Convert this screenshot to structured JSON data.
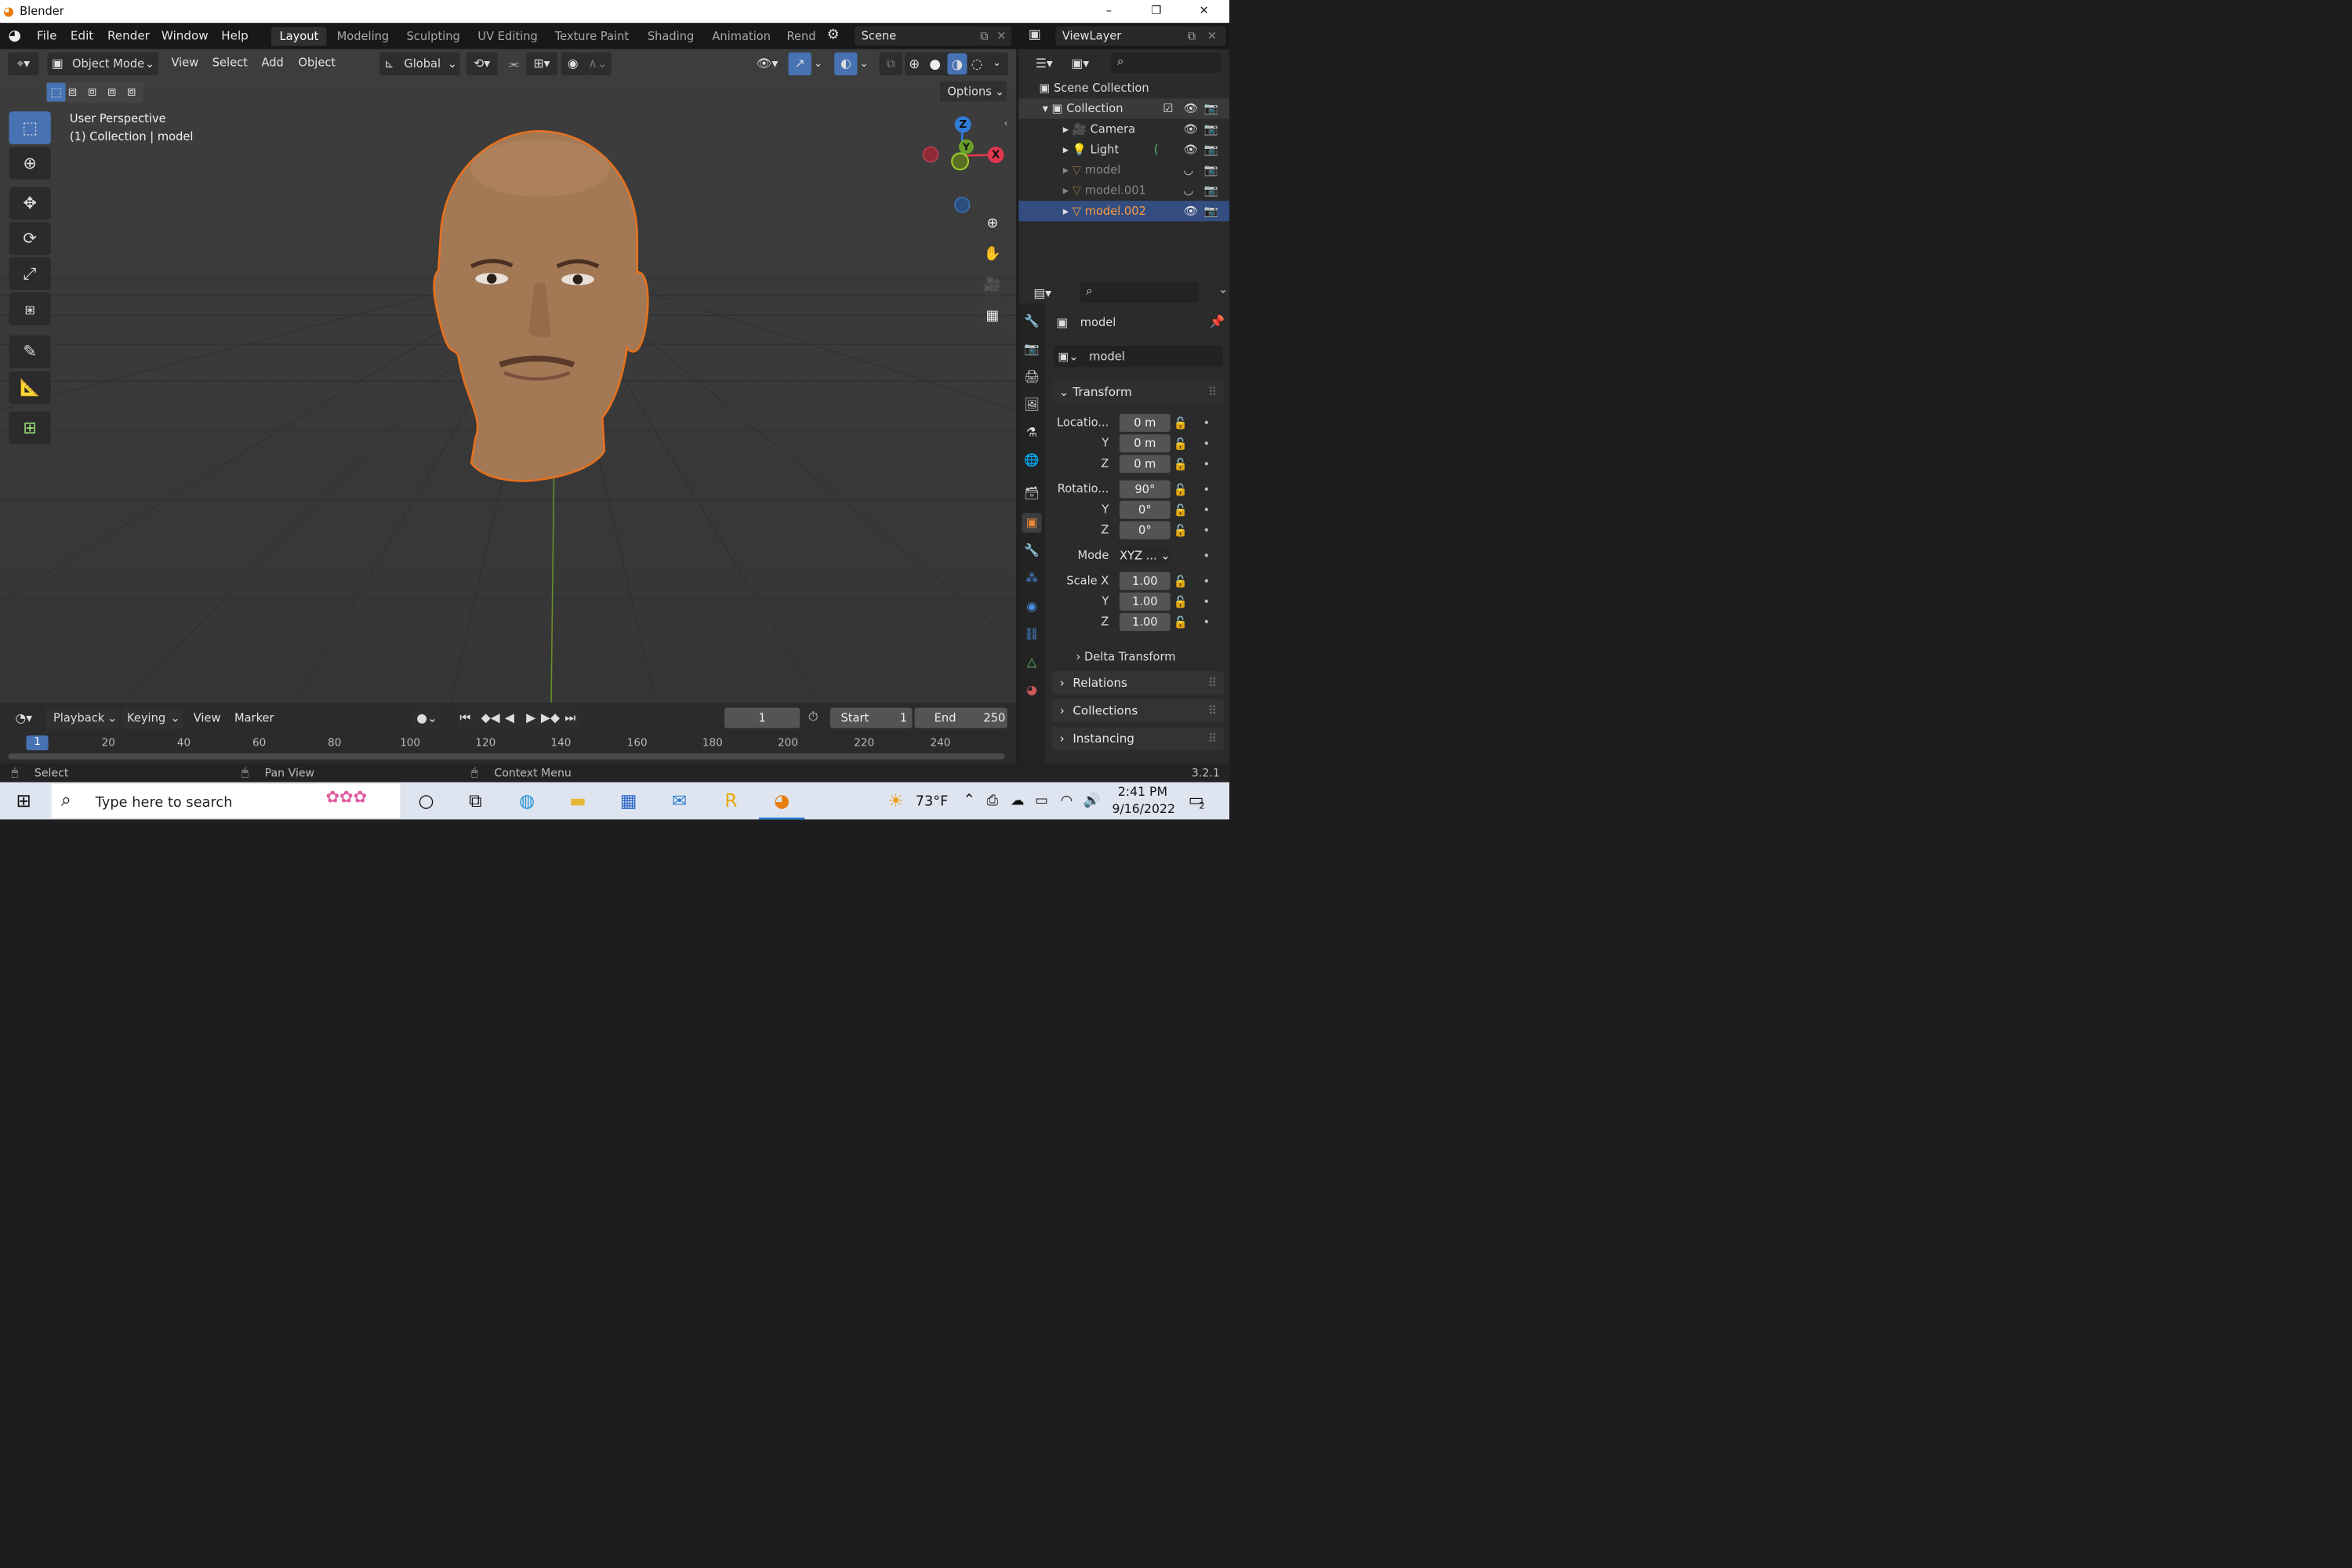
{
  "window": {
    "app_icon": "blender-logo-icon",
    "title": "Blender",
    "minimize": "–",
    "restore": "❐",
    "close": "✕"
  },
  "topbar": {
    "menus": [
      "File",
      "Edit",
      "Render",
      "Window",
      "Help"
    ],
    "workspaces": [
      "Layout",
      "Modeling",
      "Sculpting",
      "UV Editing",
      "Texture Paint",
      "Shading",
      "Animation",
      "Rend"
    ],
    "active_workspace": "Layout",
    "scene": "Scene",
    "view_layer": "ViewLayer"
  },
  "viewport": {
    "mode": "Object Mode",
    "menus": [
      "View",
      "Select",
      "Add",
      "Object"
    ],
    "orientation": "Global",
    "options": "Options",
    "info_line1": "User Perspective",
    "info_line2": "(1) Collection | model",
    "gizmo": {
      "x": "X",
      "y": "Y",
      "z": "Z"
    },
    "accent": "#4772b3",
    "selection_outline": "#e5711f"
  },
  "outliner": {
    "root": "Scene Collection",
    "collection": "Collection",
    "items": [
      {
        "name": "Camera",
        "icon": "camera-icon",
        "selected": false,
        "hidden": false
      },
      {
        "name": "Light",
        "icon": "light-icon",
        "selected": false,
        "hidden": false
      },
      {
        "name": "model",
        "icon": "mesh-icon",
        "selected": false,
        "hidden": true
      },
      {
        "name": "model.001",
        "icon": "mesh-icon",
        "selected": false,
        "hidden": true
      },
      {
        "name": "model.002",
        "icon": "mesh-icon",
        "selected": true,
        "hidden": false
      }
    ]
  },
  "properties": {
    "object_name": "model",
    "datablock": "model",
    "transform": "Transform",
    "location_label": "Locatio...",
    "location": [
      "0 m",
      "0 m",
      "0 m"
    ],
    "rotation_label": "Rotatio...",
    "rotation": [
      "90°",
      "0°",
      "0°"
    ],
    "mode_label": "Mode",
    "mode": "XYZ ...",
    "scale_label": "Scale X",
    "scale": [
      "1.00",
      "1.00",
      "1.00"
    ],
    "y": "Y",
    "z": "Z",
    "delta": "Delta Transform",
    "panels": [
      "Relations",
      "Collections",
      "Instancing"
    ]
  },
  "timeline": {
    "menus": [
      "Playback",
      "Keying",
      "View",
      "Marker"
    ],
    "current_frame": "1",
    "start_label": "Start",
    "start": "1",
    "end_label": "End",
    "end": "250",
    "ruler": [
      "1",
      "20",
      "40",
      "60",
      "80",
      "100",
      "120",
      "140",
      "160",
      "180",
      "200",
      "220",
      "240"
    ]
  },
  "statusbar": {
    "select": "Select",
    "pan": "Pan View",
    "context": "Context Menu",
    "version": "3.2.1"
  },
  "taskbar": {
    "search_placeholder": "Type here to search",
    "weather": "73°F",
    "time": "2:41 PM",
    "date": "9/16/2022",
    "notifications": "2"
  }
}
